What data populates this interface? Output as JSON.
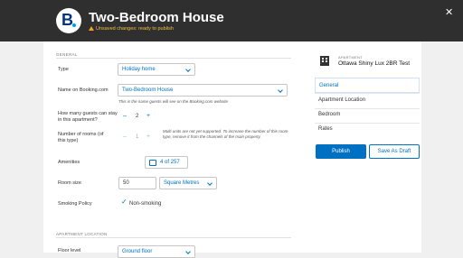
{
  "header": {
    "title": "Two-Bedroom House",
    "status": "Unsaved changes: ready to publish",
    "close_glyph": "✕"
  },
  "sections": {
    "general": "GENERAL",
    "apartment_location": "APARTMENT LOCATION"
  },
  "form": {
    "type_label": "Type",
    "type_value": "Holiday home",
    "name_label": "Name on Booking.com",
    "name_value": "Two-Bedroom House",
    "name_hint": "This is the name guests will see on the Booking.com website",
    "guests_label": "How many guests can stay in this apartment?",
    "guests_value": "2",
    "units_label": "Number of rooms (of this type)",
    "units_value": "1",
    "units_hint": "Multi units are not yet supported. To increase the number of this room type, remove it from the channels of the main property.",
    "amenities_label": "Amenities",
    "amenities_value": "4 of 257",
    "room_size_label": "Room size",
    "room_size_value": "50",
    "room_size_unit": "Square Metres",
    "smoking_label": "Smoking Policy",
    "smoking_value": "Non-smoking",
    "floor_label": "Floor level",
    "floor_value": "Ground floor"
  },
  "sidebar": {
    "kicker": "APARTMENT",
    "apartment_name": "Ottawa Shiny Lux 2BR Test",
    "nav": [
      "General",
      "Apartment Location",
      "Bedroom",
      "Rates"
    ],
    "publish_label": "Publish",
    "save_draft_label": "Save As Draft"
  },
  "colors": {
    "accent": "#0071c2",
    "header_bg": "#2f2f2f",
    "warning": "#f0c040"
  }
}
